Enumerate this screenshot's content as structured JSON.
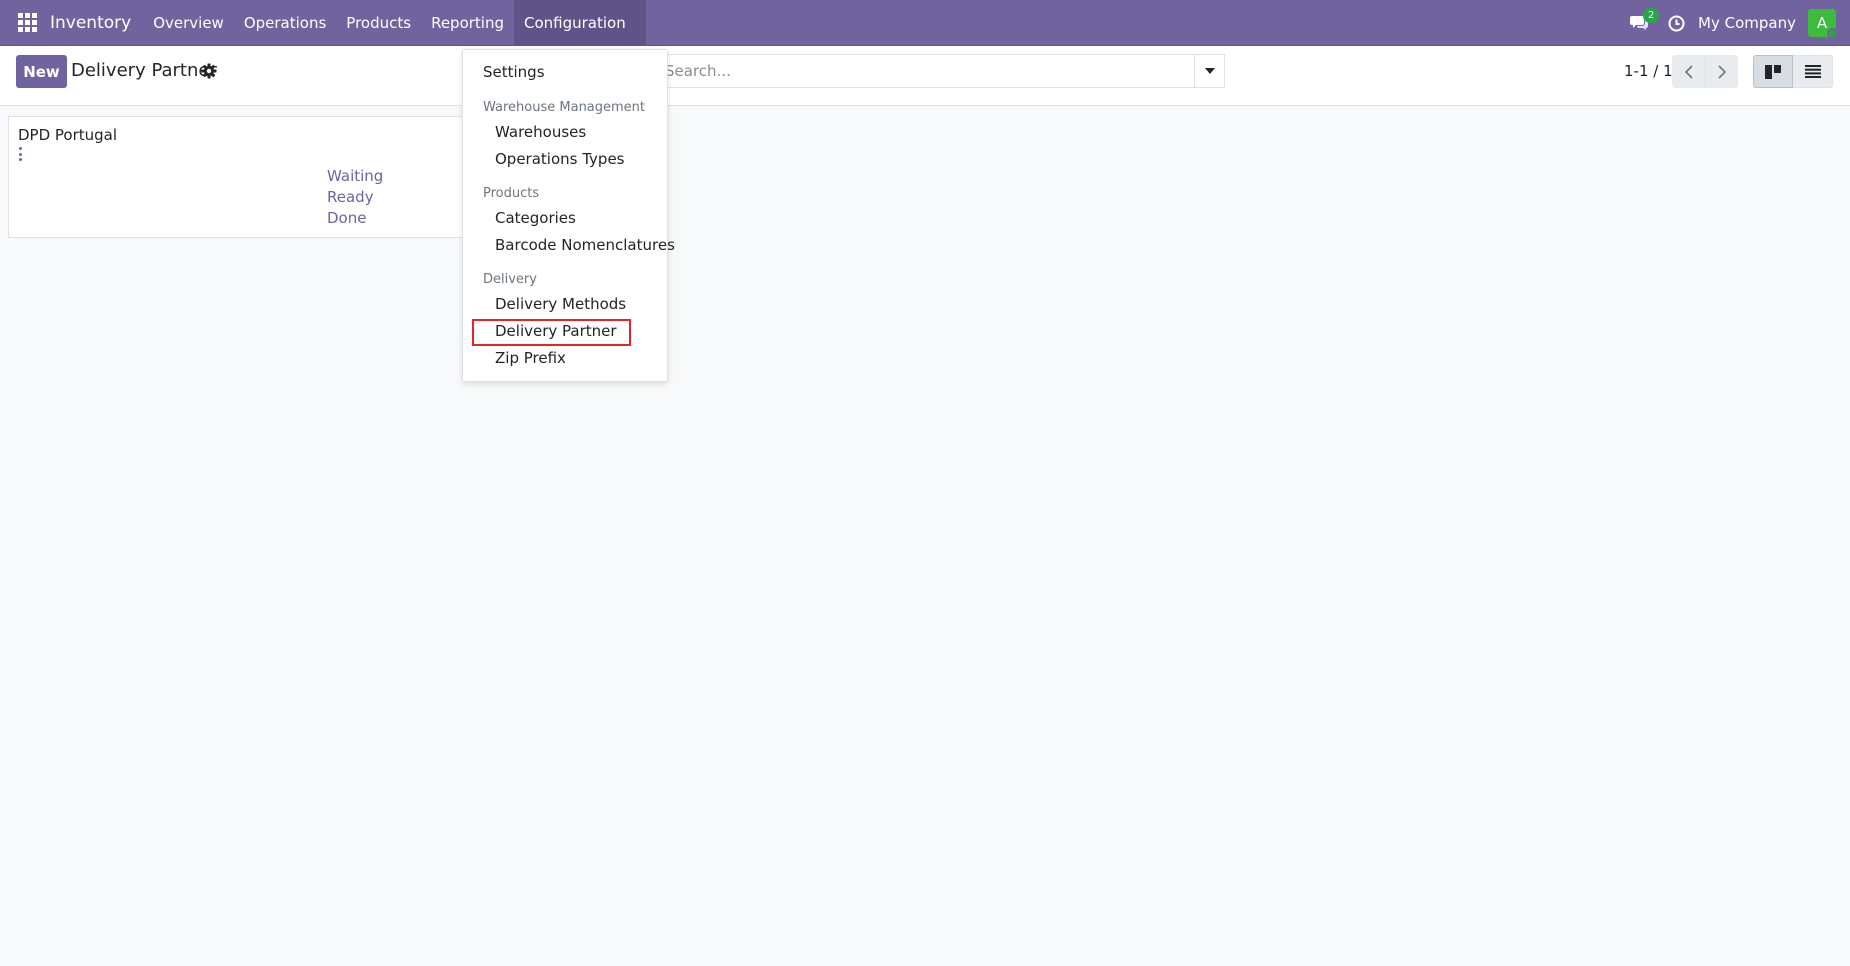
{
  "navbar": {
    "app_name": "Inventory",
    "menu": [
      "Overview",
      "Operations",
      "Products",
      "Reporting",
      "Configuration"
    ],
    "messages_count": "2",
    "company": "My Company",
    "avatar_letter": "A",
    "color": "#71639e"
  },
  "control_panel": {
    "new_button": "New",
    "title": "Delivery Partner",
    "search_placeholder": "Search...",
    "pager": "1-1 / 1"
  },
  "kanban": {
    "cards": [
      {
        "name": "DPD Portugal",
        "links": [
          "Waiting",
          "Ready",
          "Done"
        ]
      }
    ]
  },
  "config_menu": {
    "settings": "Settings",
    "sections": [
      {
        "header": "Warehouse Management",
        "items": [
          "Warehouses",
          "Operations Types"
        ]
      },
      {
        "header": "Products",
        "items": [
          "Categories",
          "Barcode Nomenclatures"
        ]
      },
      {
        "header": "Delivery",
        "items": [
          "Delivery Methods",
          "Delivery Partner",
          "Zip Prefix"
        ]
      }
    ],
    "highlighted_item": "Delivery Partner",
    "highlight_color": "#e0262b"
  }
}
